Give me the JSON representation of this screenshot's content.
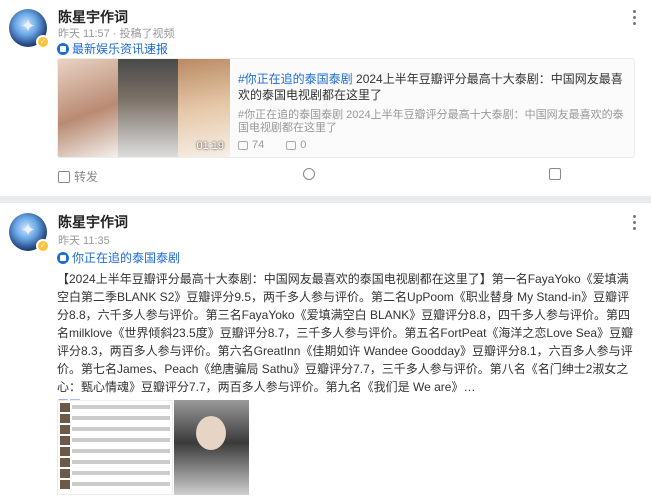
{
  "card1": {
    "author": "陈星宇作词",
    "meta": "昨天 11:57 · 投稿了视频",
    "topic": "最新娱乐资讯速报",
    "repost": {
      "tag": "#你正在追的泰国泰剧",
      "title_rest": " 2024上半年豆瓣评分最高十大泰剧：中国网友最喜欢的泰国电视剧都在这里了",
      "subtitle": "#你正在追的泰国泰剧 2024上半年豆瓣评分最高十大泰剧：中国网友最喜欢的泰国电视剧都在这里了",
      "duration": "01:19",
      "plays": "74",
      "danmaku": "0"
    },
    "actions": {
      "forward": "转发"
    }
  },
  "card2": {
    "author": "陈星宇作词",
    "meta": "昨天 11:35",
    "topic": "你正在追的泰国泰剧",
    "body": "【2024上半年豆瓣评分最高十大泰剧：中国网友最喜欢的泰国电视剧都在这里了】第一名FayaYoko《爱填满空白第二季BLANK S2》豆瓣评分9.5，两千多人参与评价。第二名UpPoom《职业替身 My Stand-in》豆瓣评分8.8，六千多人参与评价。第三名FayaYoko《爱填满空白 BLANK》豆瓣评分8.8，四千多人参与评价。第四名milklove《世界倾斜23.5度》豆瓣评分8.7，三千多人参与评价。第五名FortPeat《海洋之恋Love Sea》豆瓣评分8.3，两百多人参与评价。第六名GreatInn《佳期如许 Wandee Goodday》豆瓣评分8.1，六百多人参与评价。第七名James、Peach《绝唐骗局 Sathu》豆瓣评分7.7，三千多人参与评价。第八名《名门绅士2淑女之心：甄心情魂》豆瓣评分7.7，两百多人参与评价。第九名《我们是 We are》…",
    "expand": "展开"
  },
  "colors": {
    "link": "#1e6bd6",
    "badge": "#ffc23a"
  }
}
